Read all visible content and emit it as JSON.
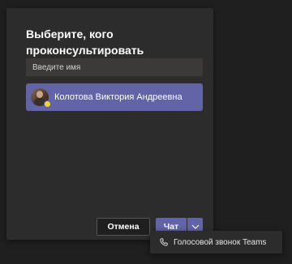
{
  "dialog": {
    "title": "Выберите, кого проконсультировать",
    "search": {
      "placeholder": "Введите имя"
    },
    "result": {
      "name": "Колотова Виктория Андреевна",
      "status_color": "#f8d22a"
    },
    "buttons": {
      "cancel_label": "Отмена",
      "chat_label": "Чат",
      "dropdown_icon": "chevron-down-icon"
    }
  },
  "dropdown_menu": {
    "items": [
      {
        "label": "Голосовой звонок Teams",
        "icon": "phone-icon"
      }
    ]
  },
  "colors": {
    "accent": "#6264a7",
    "background": "#1f1f1f",
    "dialog": "#2d2c2c"
  }
}
